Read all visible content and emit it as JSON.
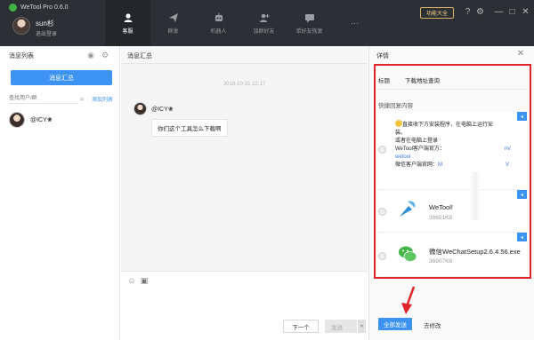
{
  "app": {
    "title": "WeTool Pro 0.6.0",
    "user_name": "sun杉",
    "logout": "退出登录",
    "feature_btn": "功能大全"
  },
  "nav": [
    {
      "label": "客服",
      "icon": "chat-person-icon",
      "active": true
    },
    {
      "label": "群发",
      "icon": "send-icon",
      "active": false
    },
    {
      "label": "机器人",
      "icon": "robot-icon",
      "active": false
    },
    {
      "label": "加群好友",
      "icon": "add-friend-icon",
      "active": false
    },
    {
      "label": "单好友恢复",
      "icon": "message-icon",
      "active": false
    },
    {
      "label": "···",
      "icon": "more-icon",
      "active": false
    }
  ],
  "left": {
    "header": "消息列表",
    "summary_btn": "消息汇总",
    "search_placeholder": "查找用户/群",
    "add_list": "添加列表",
    "contacts": [
      {
        "name": "@ICY❀"
      }
    ]
  },
  "middle": {
    "header": "消息汇总",
    "timestamp": "2018-10-31 22:17",
    "sender": "@ICY❀",
    "message": "你们这个工具怎么下载啊",
    "next_btn": "下一个",
    "send_btn": "发送",
    "send_caret": "▾"
  },
  "right": {
    "header": "详情",
    "field_label": "标题",
    "field_value": "下载地址查询",
    "quick_label": "快捷回复内容",
    "card1": {
      "line1": "直接收下方安装程序，在电脑上运行安",
      "line2": "装。",
      "line3": "或者在电脑上登录",
      "line4_a": "WeTool客户端官方：",
      "line4_b": "m/",
      "line5": "wetool",
      "line6_a": "微信客户端官网：",
      "line6_b": "M",
      "line6_c": "V"
    },
    "card2": {
      "name": "WeTool!",
      "size": "38651K8"
    },
    "card3": {
      "name": "微信WeChatSetup2.6.4.56.exe",
      "size": "36907K8"
    },
    "send_all_btn": "全部发送",
    "edit_link": "去修改"
  },
  "colors": {
    "accent": "#3c93f2",
    "highlight": "#e0242b",
    "topbar": "#2c2f33"
  }
}
